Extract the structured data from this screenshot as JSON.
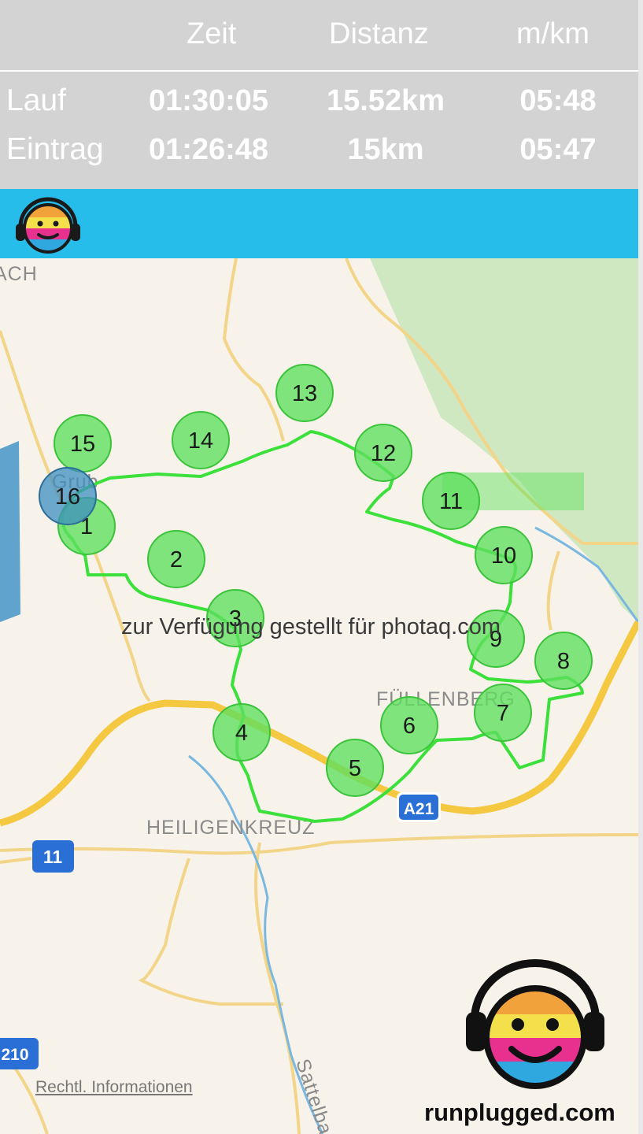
{
  "stats": {
    "headers": {
      "time": "Zeit",
      "distance": "Distanz",
      "pace": "m/km"
    },
    "rows": [
      {
        "label": "Lauf",
        "time": "01:30:05",
        "distance": "15.52km",
        "pace": "05:48"
      },
      {
        "label": "Eintrag",
        "time": "01:26:48",
        "distance": "15km",
        "pace": "05:47"
      }
    ]
  },
  "map": {
    "places": {
      "top_left": "ACH",
      "grub": "Grub",
      "fuellenberg": "FÜLLENBERG",
      "heiligenkreuz": "HEILIGENKREUZ"
    },
    "road_shields": {
      "a21": "A21",
      "b11": "11",
      "b210": "210"
    },
    "stream_label": "Sattelbach",
    "markers": [
      "1",
      "2",
      "3",
      "4",
      "5",
      "6",
      "7",
      "8",
      "9",
      "10",
      "11",
      "12",
      "13",
      "14",
      "15",
      "16"
    ],
    "marker_color": "#5fe05f",
    "route_color": "#3be03b",
    "current_marker_color": "#3d8fc0"
  },
  "watermark": "zur Verfügung gestellt für photaq.com",
  "legal_link": "Rechtl. Informationen",
  "brand": "runplugged.com",
  "colors": {
    "banner": "#27bdea",
    "stats_bg": "#d3d3d3",
    "motorway": "#f5c842",
    "water": "#7ab8e0",
    "forest": "#cfe8c2"
  },
  "icons": {
    "banner_logo": "smiley-headphones-icon",
    "brand_logo": "smiley-headphones-icon"
  }
}
